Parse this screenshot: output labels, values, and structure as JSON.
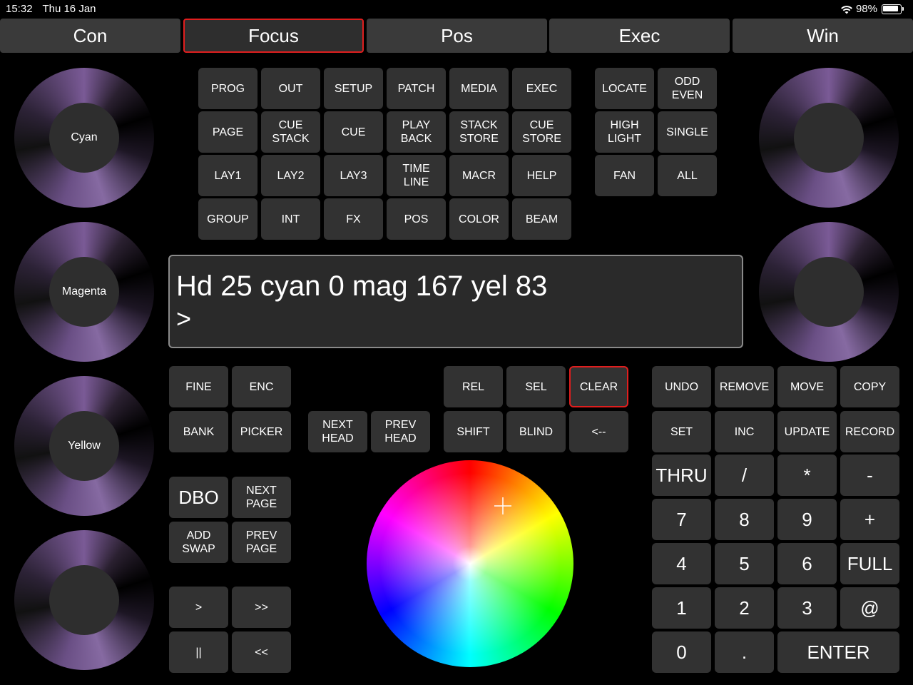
{
  "status_bar": {
    "time": "15:32",
    "date": "Thu 16 Jan",
    "battery": "98%"
  },
  "tabs": [
    {
      "label": "Con"
    },
    {
      "label": "Focus",
      "active": true
    },
    {
      "label": "Pos"
    },
    {
      "label": "Exec"
    },
    {
      "label": "Win"
    }
  ],
  "encoders": {
    "left": [
      "Cyan",
      "Magenta",
      "Yellow",
      ""
    ],
    "right": [
      "",
      ""
    ]
  },
  "key_grid": [
    [
      "PROG",
      "OUT",
      "SETUP",
      "PATCH",
      "MEDIA",
      "EXEC"
    ],
    [
      "PAGE",
      "CUE\nSTACK",
      "CUE",
      "PLAY\nBACK",
      "STACK\nSTORE",
      "CUE\nSTORE"
    ],
    [
      "LAY1",
      "LAY2",
      "LAY3",
      "TIME\nLINE",
      "MACR",
      "HELP"
    ],
    [
      "GROUP",
      "INT",
      "FX",
      "POS",
      "COLOR",
      "BEAM"
    ]
  ],
  "select_grid": [
    [
      "LOCATE",
      "ODD\nEVEN"
    ],
    [
      "HIGH\nLIGHT",
      "SINGLE"
    ],
    [
      "FAN",
      "ALL"
    ]
  ],
  "command_line": {
    "text": "Hd 25 cyan 0 mag 167 yel 83",
    "prompt": ">"
  },
  "left_keys": {
    "fine": "FINE",
    "enc": "ENC",
    "bank": "BANK",
    "picker": "PICKER",
    "next_head": "NEXT\nHEAD",
    "prev_head": "PREV\nHEAD",
    "dbo": "DBO",
    "next_page": "NEXT\nPAGE",
    "add_swap": "ADD\nSWAP",
    "prev_page": "PREV\nPAGE",
    "play": ">",
    "fast_forward": ">>",
    "pause": "||",
    "rewind": "<<"
  },
  "mid_keys": {
    "rel": "REL",
    "sel": "SEL",
    "clear": "CLEAR",
    "shift": "SHIFT",
    "blind": "BLIND",
    "backspace": "<--"
  },
  "edit_keys": {
    "undo": "UNDO",
    "remove": "REMOVE",
    "move": "MOVE",
    "copy": "COPY",
    "set": "SET",
    "inc": "INC",
    "update": "UPDATE",
    "record": "RECORD"
  },
  "keypad": [
    [
      "THRU",
      "/",
      "*",
      "-"
    ],
    [
      "7",
      "8",
      "9",
      "+"
    ],
    [
      "4",
      "5",
      "6",
      "FULL"
    ],
    [
      "1",
      "2",
      "3",
      "@"
    ]
  ],
  "keypad_bottom": {
    "zero": "0",
    "dot": ".",
    "enter": "ENTER"
  },
  "colors": {
    "background": "#000000",
    "button": "#323232",
    "active_border": "#e01e1e"
  }
}
